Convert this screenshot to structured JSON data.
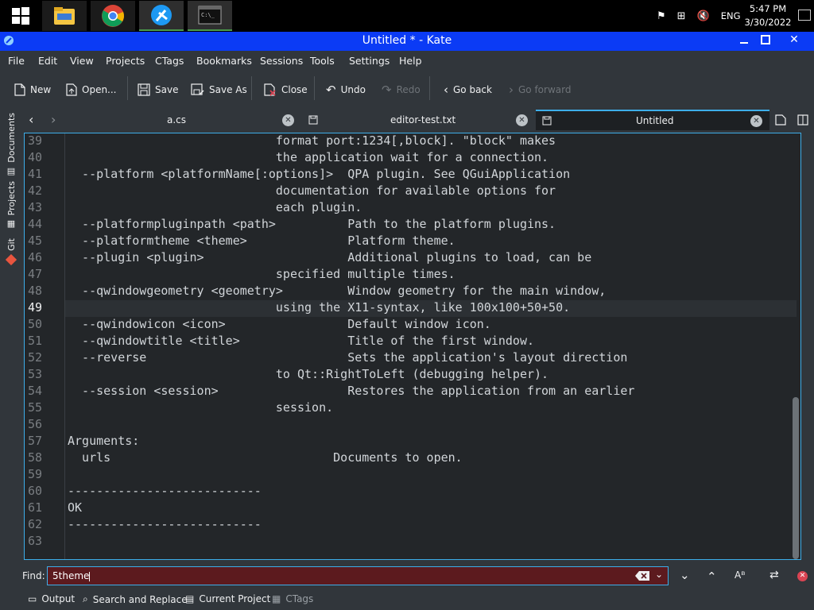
{
  "taskbar": {
    "clock_time": "5:47 PM",
    "clock_date": "3/30/2022",
    "lang": "ENG"
  },
  "window": {
    "title": "Untitled * - Kate"
  },
  "menu": [
    "File",
    "Edit",
    "View",
    "Projects",
    "CTags",
    "Bookmarks",
    "Sessions",
    "Tools",
    "Settings",
    "Help"
  ],
  "toolbar": {
    "new": "New",
    "open": "Open...",
    "save": "Save",
    "save_as": "Save As",
    "close": "Close",
    "undo": "Undo",
    "redo": "Redo",
    "go_back": "Go back",
    "go_forward": "Go forward"
  },
  "sidebar": {
    "documents": "Documents",
    "projects": "Projects",
    "git": "Git"
  },
  "tabs": [
    {
      "label": "a.cs"
    },
    {
      "label": "editor-test.txt"
    },
    {
      "label": "Untitled"
    }
  ],
  "editor": {
    "current_line": "49",
    "lines": [
      {
        "n": "39",
        "text": "                             format port:1234[,block]. \"block\" makes"
      },
      {
        "n": "40",
        "text": "                             the application wait for a connection."
      },
      {
        "n": "41",
        "text": "  --platform <platformName[:options]>  QPA plugin. See QGuiApplication"
      },
      {
        "n": "42",
        "text": "                             documentation for available options for"
      },
      {
        "n": "43",
        "text": "                             each plugin."
      },
      {
        "n": "44",
        "text": "  --platformpluginpath <path>          Path to the platform plugins."
      },
      {
        "n": "45",
        "text": "  --platformtheme <theme>              Platform theme."
      },
      {
        "n": "46",
        "text": "  --plugin <plugin>                    Additional plugins to load, can be"
      },
      {
        "n": "47",
        "text": "                             specified multiple times."
      },
      {
        "n": "48",
        "text": "  --qwindowgeometry <geometry>         Window geometry for the main window,"
      },
      {
        "n": "49",
        "text": "                             using the X11-syntax, like 100x100+50+50."
      },
      {
        "n": "50",
        "text": "  --qwindowicon <icon>                 Default window icon."
      },
      {
        "n": "51",
        "text": "  --qwindowtitle <title>               Title of the first window."
      },
      {
        "n": "52",
        "text": "  --reverse                            Sets the application's layout direction"
      },
      {
        "n": "53",
        "text": "                             to Qt::RightToLeft (debugging helper)."
      },
      {
        "n": "54",
        "text": "  --session <session>                  Restores the application from an earlier"
      },
      {
        "n": "55",
        "text": "                             session."
      },
      {
        "n": "56",
        "text": ""
      },
      {
        "n": "57",
        "text": "Arguments:"
      },
      {
        "n": "58",
        "text": "  urls                               Documents to open."
      },
      {
        "n": "59",
        "text": ""
      },
      {
        "n": "60",
        "text": "---------------------------"
      },
      {
        "n": "61",
        "text": "OK"
      },
      {
        "n": "62",
        "text": "---------------------------"
      },
      {
        "n": "63",
        "text": ""
      }
    ]
  },
  "find": {
    "label": "Find:",
    "value": "5theme"
  },
  "bottom": {
    "output": "Output",
    "search_replace": "Search and Replace",
    "current_project": "Current Project",
    "ctags": "CTags"
  },
  "colors": {
    "accent": "#3daee9",
    "titlebar": "#0b3bf5",
    "find_bg": "#5c1a1e"
  }
}
